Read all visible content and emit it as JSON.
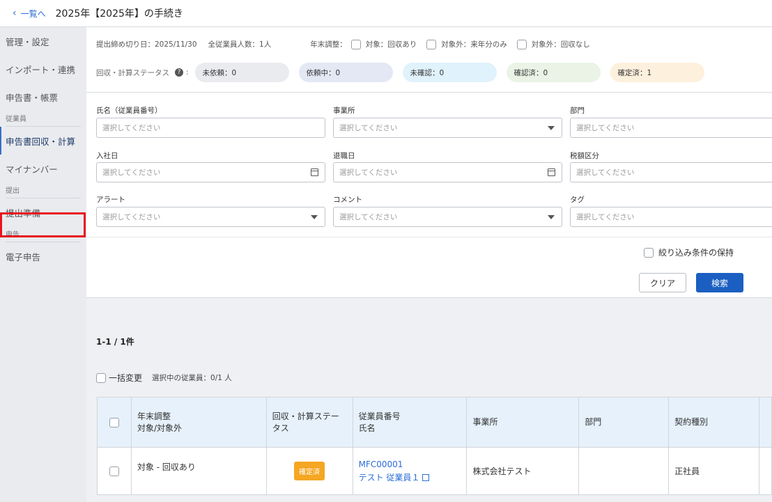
{
  "header": {
    "back_label": "一覧へ",
    "title": "2025年【2025年】の手続き"
  },
  "sidebar": {
    "items_top": [
      "管理・設定",
      "インポート・連携",
      "申告書・帳票"
    ],
    "section_employee": "従業員",
    "employee_items": [
      "申告書回収・計算",
      "マイナンバー"
    ],
    "section_submit": "提出",
    "submit_items": [
      "提出準備"
    ],
    "section_declare": "申告",
    "declare_items": [
      "電子申告"
    ]
  },
  "info": {
    "deadline": "提出締め切り日：2025/11/30",
    "employees": "全従業員人数：1人",
    "year_end_label": "年末調整：",
    "options": [
      "対象：回収あり",
      "対象外：来年分のみ",
      "対象外：回収なし"
    ]
  },
  "status": {
    "label": "回収・計算ステータス",
    "suffix": ":",
    "pills": [
      {
        "label": "未依頼：0",
        "color": "#e9ebef"
      },
      {
        "label": "依頼中：0",
        "color": "#e4e7f4"
      },
      {
        "label": "未確認：0",
        "color": "#e0f2fc"
      },
      {
        "label": "確認済：0",
        "color": "#eaf3e6"
      },
      {
        "label": "確定済：1",
        "color": "#fdf0dc"
      }
    ]
  },
  "filters": {
    "placeholder": "選択してください",
    "name_label": "氏名（従業員番号）",
    "office_label": "事業所",
    "dept_label": "部門",
    "hire_label": "入社日",
    "retire_label": "退職日",
    "tax_label": "税額区分",
    "alert_label": "アラート",
    "comment_label": "コメント",
    "tag_label": "タグ",
    "keep_label": "絞り込み条件の保持",
    "clear_label": "クリア",
    "search_label": "検索"
  },
  "results": {
    "count": "1-1 / 1件",
    "bulk_label": "一括変更",
    "selected": "選択中の従業員：0/1 人"
  },
  "table": {
    "headers": {
      "year_end_1": "年末調整",
      "year_end_2": "対象/対象外",
      "status_1": "回収・計算ステー",
      "status_2": "タス",
      "emp_1": "従業員番号",
      "emp_2": "氏名",
      "office": "事業所",
      "dept": "部門",
      "contract": "契約種別"
    },
    "rows": [
      {
        "year_end": "対象 - 回収あり",
        "status": "確定済",
        "emp_no": "MFC00001",
        "name": "テスト 従業員１",
        "office": "株式会社テスト",
        "dept": "",
        "contract": "正社員"
      }
    ]
  }
}
